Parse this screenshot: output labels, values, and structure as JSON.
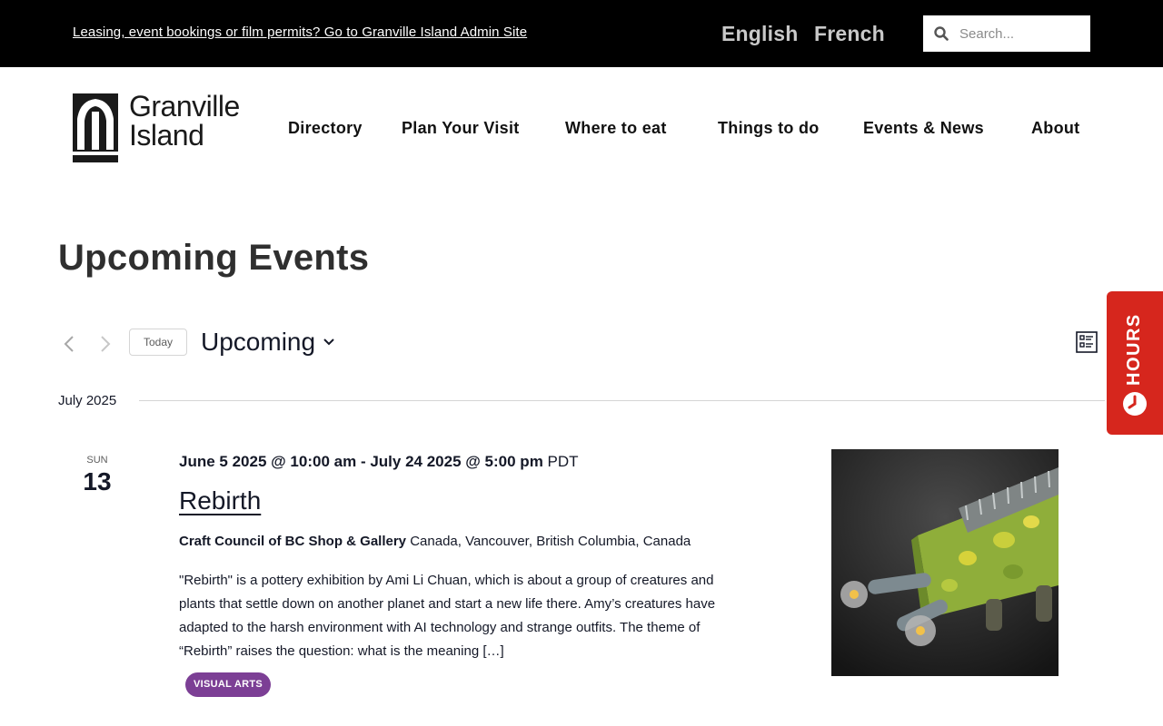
{
  "topbar": {
    "admin_link": "Leasing, event bookings or film permits? Go to Granville Island Admin Site",
    "languages": [
      "English",
      "French"
    ],
    "search_placeholder": "Search..."
  },
  "brand": {
    "logo_line1": "Granville",
    "logo_line2": "Island"
  },
  "nav": {
    "items": [
      "Directory",
      "Plan Your Visit",
      "Where to eat",
      "Things to do",
      "Events & News",
      "About"
    ]
  },
  "page": {
    "title": "Upcoming Events"
  },
  "controls": {
    "today_label": "Today",
    "view_label": "Upcoming"
  },
  "hours_tab": {
    "label": "HOURS",
    "color": "#d6261d"
  },
  "month": {
    "label": "July 2025"
  },
  "event": {
    "day_of_week": "SUN",
    "day": "13",
    "start": "June 5 2025 @ 10:00 am",
    "separator": "-",
    "end": "July 24 2025 @ 5:00 pm",
    "timezone": "PDT",
    "title": "Rebirth",
    "venue_name": "Craft Council of BC Shop & Gallery",
    "venue_address": "Canada, Vancouver, British Columbia, Canada",
    "description": "\"Rebirth\" is a pottery exhibition by Ami Li Chuan, which is about a group of creatures and plants that settle down on another planet and start a new life there. Amy’s creatures have adapted to the harsh environment with AI technology and strange outfits. The theme of “Rebirth” raises the question: what is the meaning […]",
    "category": "VISUAL ARTS",
    "category_color": "#7c3f95"
  }
}
